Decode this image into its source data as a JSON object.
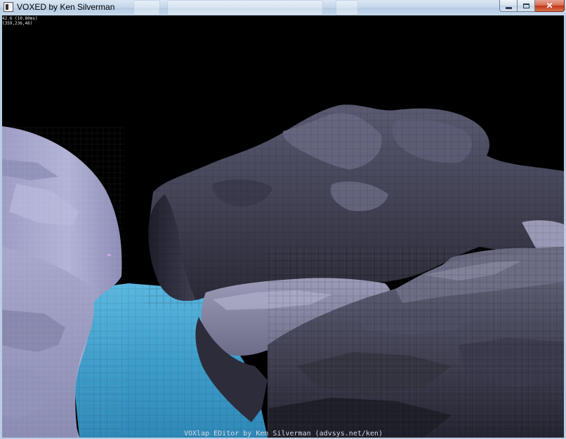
{
  "window": {
    "title": "VOXED by Ken Silverman",
    "controls": {
      "minimize": "minimize-button",
      "maximize": "maximize-button",
      "close": "close-button",
      "close_glyph": "✕"
    }
  },
  "hud": {
    "fps": "42.6 (10.80ms)",
    "position": "(359,236,46)"
  },
  "footer": {
    "credits": "VOXlap EDitor by Ken Silverman (advsys.net/ken)"
  },
  "scene": {
    "background": "#000000",
    "water_color": "#3f9ecb",
    "rock_light": "#a3a4c8",
    "rock_dark": "#2c2b3a"
  }
}
